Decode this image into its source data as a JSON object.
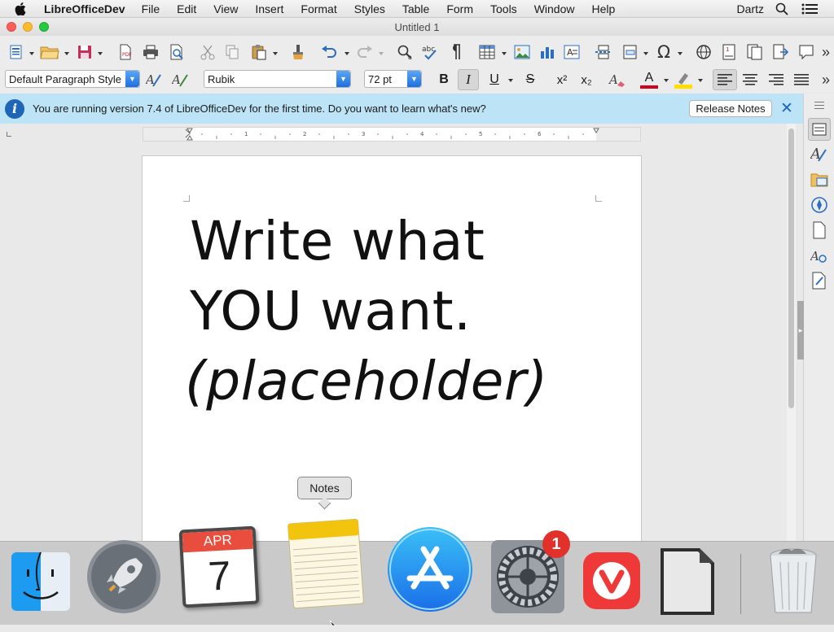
{
  "menubar": {
    "app_name": "LibreOfficeDev",
    "items": [
      "File",
      "Edit",
      "View",
      "Insert",
      "Format",
      "Styles",
      "Table",
      "Form",
      "Tools",
      "Window",
      "Help"
    ],
    "user": "Dartz"
  },
  "window": {
    "title": "Untitled 1"
  },
  "formatting": {
    "paragraph_style": "Default Paragraph Style",
    "font_name": "Rubik",
    "font_size": "72 pt",
    "bold_label": "B",
    "italic_label": "I",
    "underline_label": "U",
    "strike_label": "S",
    "superscript_label": "x²",
    "subscript_label": "x₂",
    "font_color_label": "A"
  },
  "infobar": {
    "message": "You are running version 7.4 of LibreOfficeDev for the first time. Do you want to learn what's new?",
    "button_label": "Release Notes",
    "close_label": "✕"
  },
  "document": {
    "lines": [
      "Write what",
      "YOU want.",
      "(placeholder)"
    ]
  },
  "dock": {
    "tooltip": "Notes",
    "calendar_month": "APR",
    "calendar_day": "7",
    "settings_badge": "1",
    "apps": [
      "Finder",
      "Launchpad",
      "Calendar",
      "Notes",
      "App Store",
      "System Preferences",
      "Vivaldi",
      "LibreOfficeDev",
      "Trash"
    ]
  },
  "colors": {
    "infobar_bg": "#bde4f6",
    "accent_blue": "#1d6fe0",
    "font_color_red": "#d0021b",
    "highlight_yellow": "#ffde00"
  }
}
